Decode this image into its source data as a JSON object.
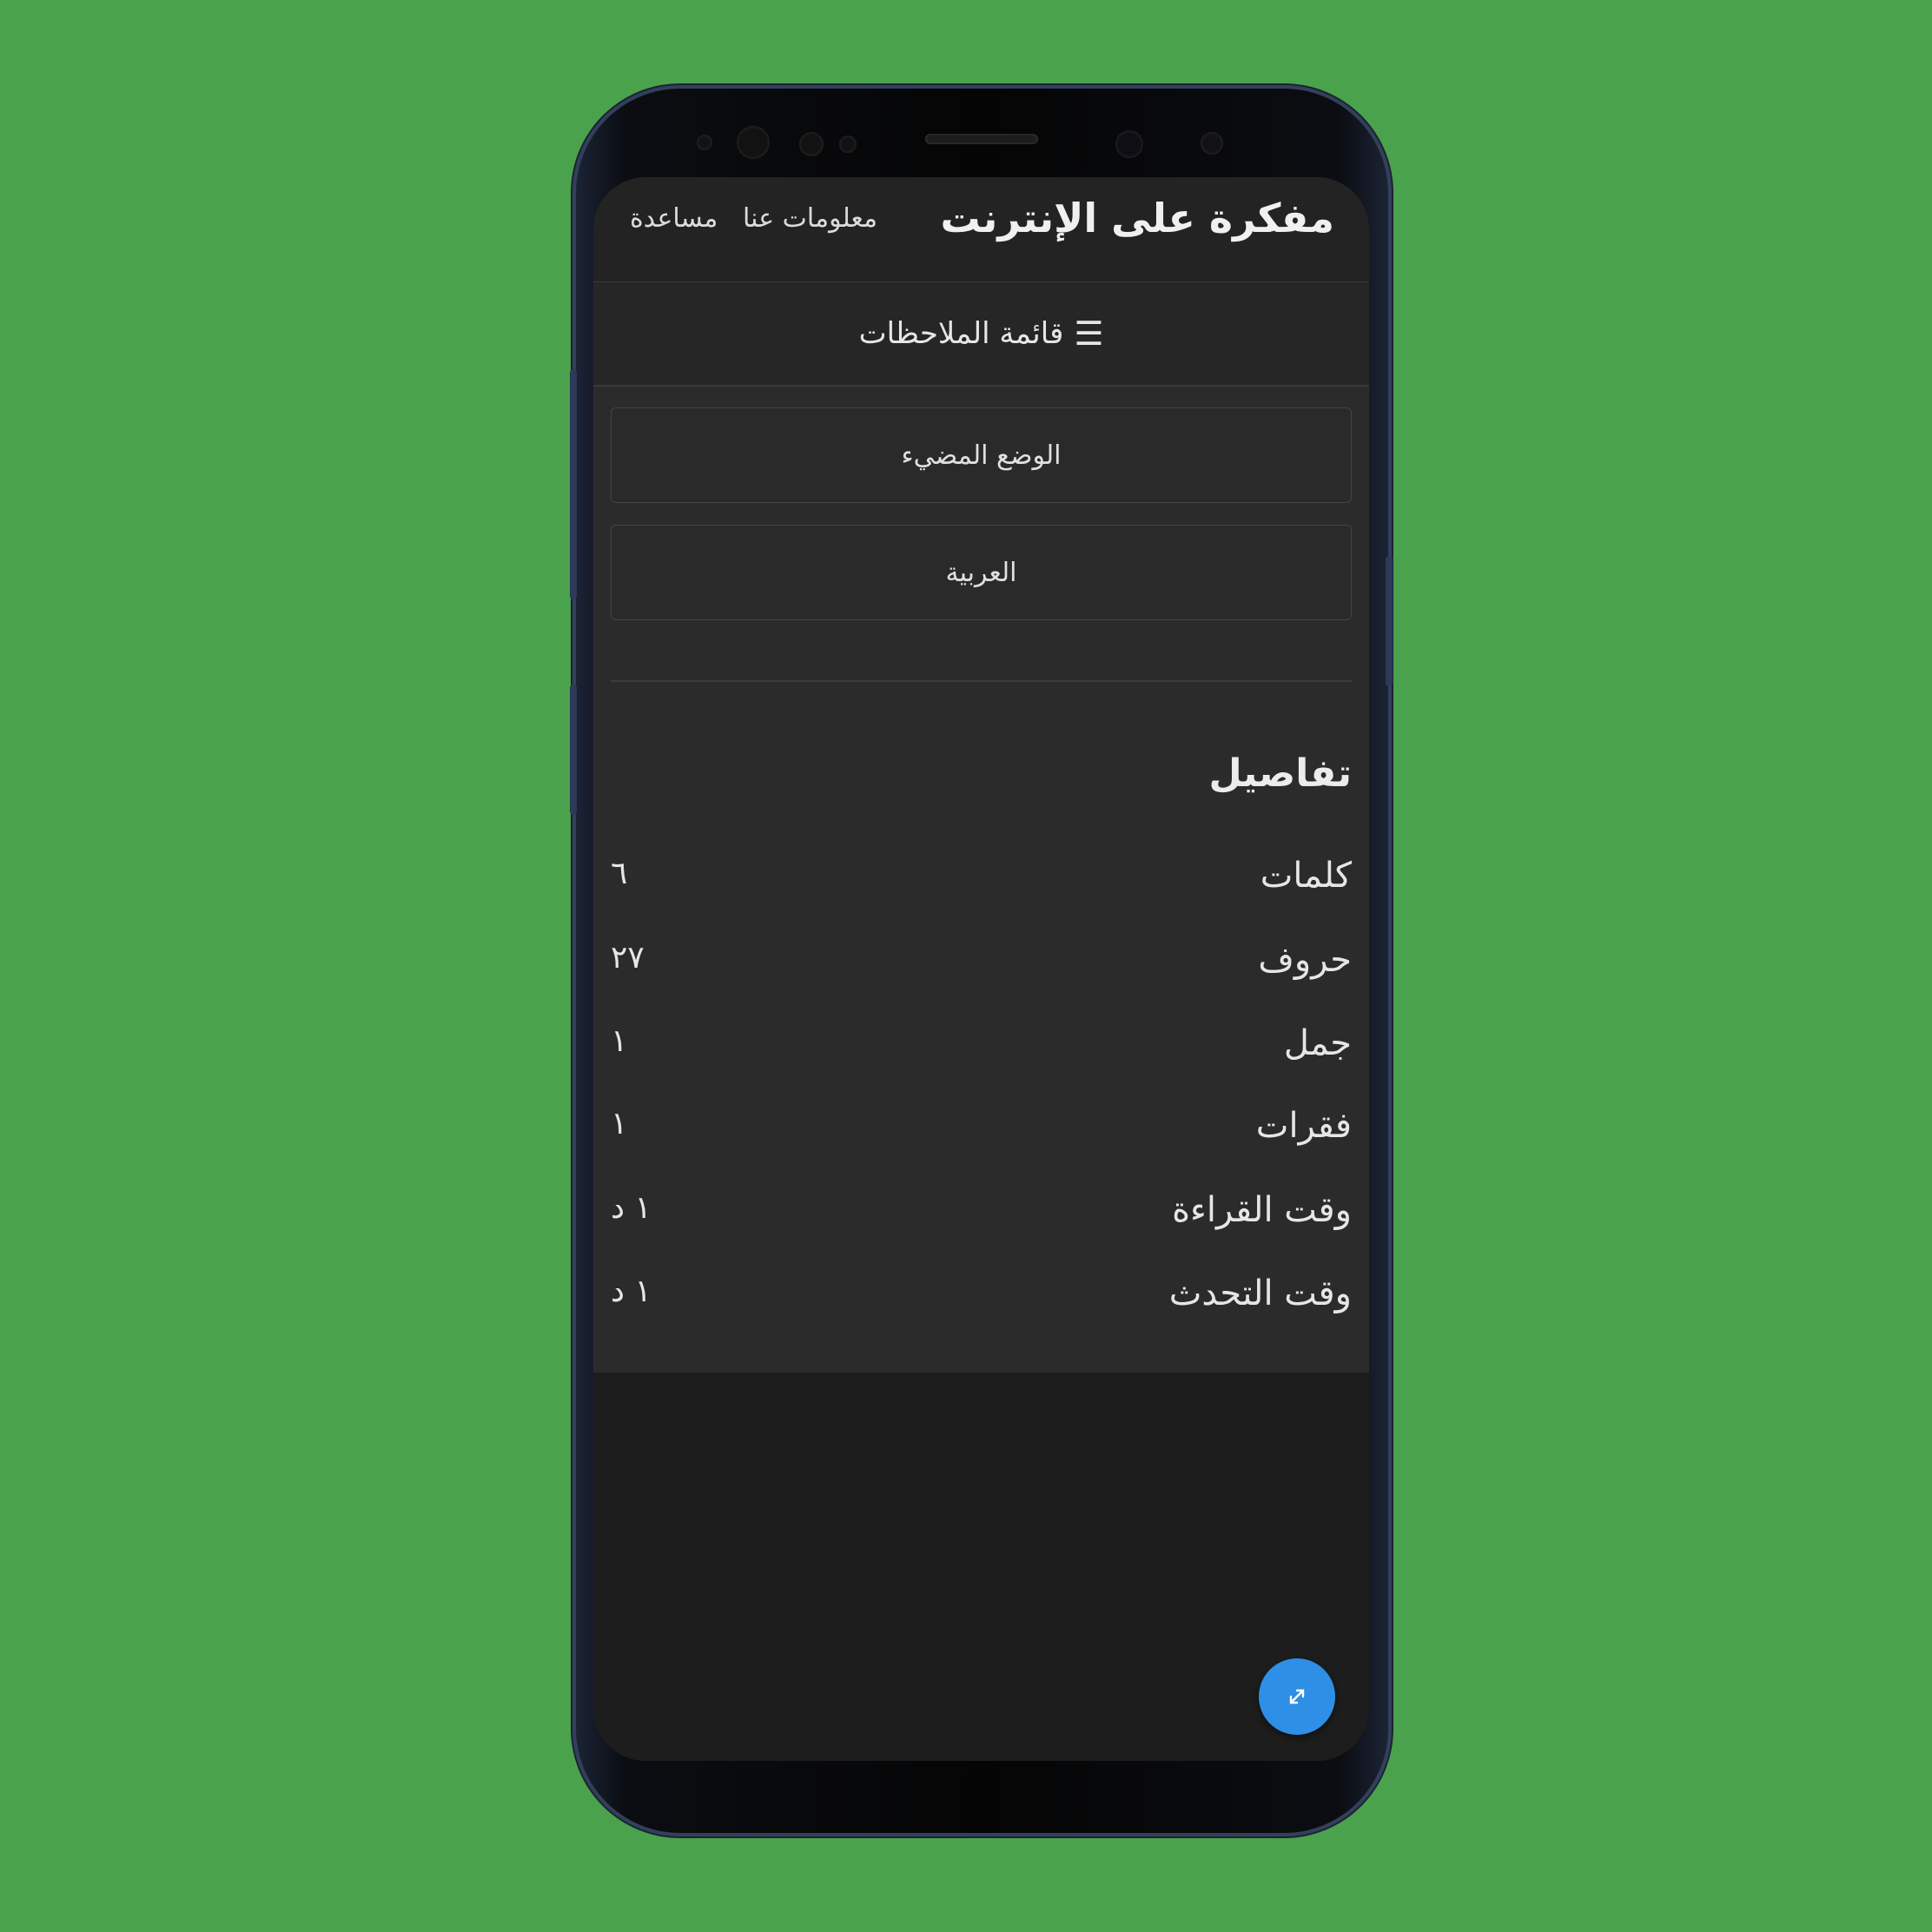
{
  "header": {
    "title": "مفكرة على الإنترنت",
    "nav": [
      "معلومات عنا",
      "مساعدة"
    ]
  },
  "notes_list": {
    "icon": "hamburger-icon",
    "label": "قائمة الملاحظات"
  },
  "settings": {
    "theme_button": "الوضع المضيء",
    "language_button": "العربية"
  },
  "details": {
    "title": "تفاصيل",
    "rows": [
      {
        "label": "كلمات",
        "value": "٦"
      },
      {
        "label": "حروف",
        "value": "٢٧"
      },
      {
        "label": "جمل",
        "value": "١"
      },
      {
        "label": "فقرات",
        "value": "١"
      },
      {
        "label": "وقت القراءة",
        "value": "١ د"
      },
      {
        "label": "وقت التحدث",
        "value": "١ د"
      }
    ]
  },
  "fab": {
    "icon": "expand-icon"
  },
  "colors": {
    "background": "#4aa24d",
    "fab": "#2d8fe6",
    "screen": "#1d1d1d",
    "panel": "#2b2b2b"
  }
}
